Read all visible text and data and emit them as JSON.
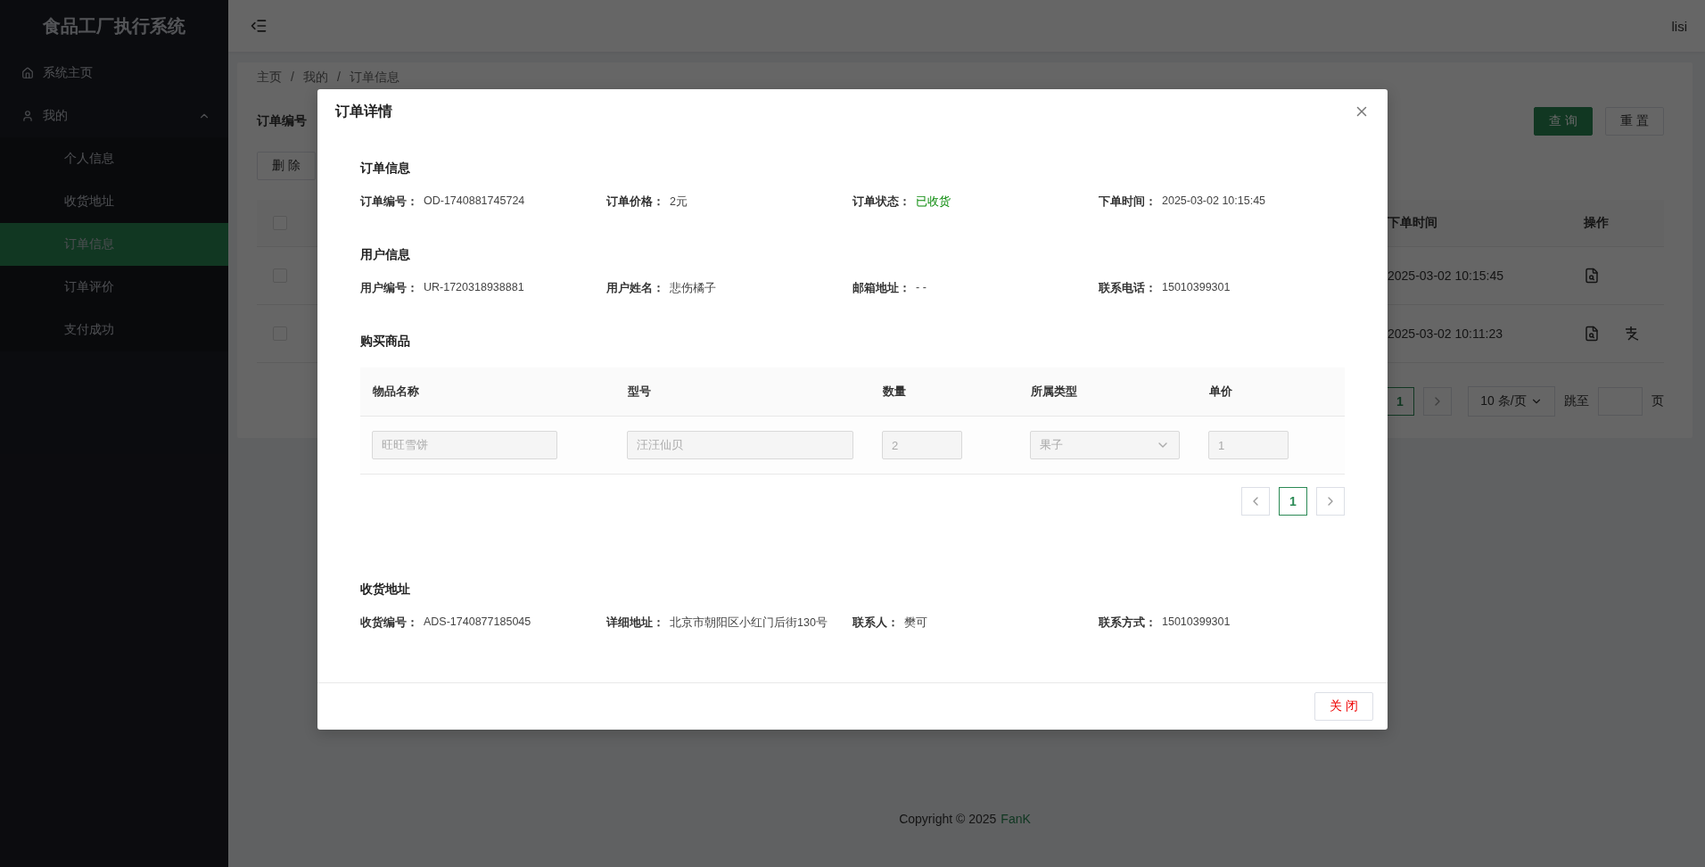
{
  "sidebar": {
    "title": "食品工厂执行系统",
    "items": [
      {
        "kind": "page",
        "label": "系统主页"
      },
      {
        "kind": "group",
        "label": "我的",
        "expanded": true,
        "children": [
          {
            "label": "个人信息",
            "selected": false
          },
          {
            "label": "收货地址",
            "selected": false
          },
          {
            "label": "订单信息",
            "selected": true
          },
          {
            "label": "订单评价",
            "selected": false
          },
          {
            "label": "支付成功",
            "selected": false
          }
        ]
      }
    ]
  },
  "header": {
    "user": "lisi"
  },
  "breadcrumb": {
    "items": [
      "主页",
      "我的",
      "订单信息"
    ],
    "separator": "/"
  },
  "filter": {
    "label": "订单编号",
    "buttons": [
      {
        "label": "查 询",
        "kind": "primary"
      },
      {
        "label": "重 置",
        "kind": "default"
      }
    ]
  },
  "toolbar": {
    "buttons": [
      "删 除"
    ]
  },
  "table": {
    "header_checked": false,
    "columns": [
      "下单时间",
      "操作"
    ],
    "rows": [
      {
        "checked": false,
        "time": "2025-03-02 10:15:45",
        "actions": [
          {
            "kind": "view"
          }
        ]
      },
      {
        "checked": false,
        "time": "2025-03-02 10:11:23",
        "actions": [
          {
            "kind": "view"
          },
          {
            "kind": "pay"
          }
        ]
      }
    ]
  },
  "pagination": {
    "pages": [
      {
        "label": "1",
        "selected": true
      }
    ],
    "page_size": "10 条/页",
    "jump_label": "跳至",
    "page_unit": "页"
  },
  "footer": {
    "text": "Copyright © 2025",
    "brand": "FanK"
  },
  "modal": {
    "title": "订单详情",
    "sections": [
      {
        "kind": "fields",
        "title": "订单信息",
        "fields": [
          {
            "label": "订单编号：",
            "value": "OD-1740881745724"
          },
          {
            "label": "订单价格：",
            "value": "2元"
          },
          {
            "label": "订单状态：",
            "value": "已收货",
            "kind": "status"
          },
          {
            "label": "下单时间：",
            "value": "2025-03-02 10:15:45"
          }
        ]
      },
      {
        "kind": "fields",
        "title": "用户信息",
        "fields": [
          {
            "label": "用户编号：",
            "value": "UR-1720318938881"
          },
          {
            "label": "用户姓名：",
            "value": "悲伤橘子"
          },
          {
            "label": "邮箱地址：",
            "value": "- -"
          },
          {
            "label": "联系电话：",
            "value": "15010399301"
          }
        ]
      },
      {
        "kind": "goods",
        "title": "购买商品",
        "columns": [
          "物品名称",
          "型号",
          "数量",
          "所属类型",
          "单价"
        ],
        "rows": [
          {
            "cells": [
              {
                "kind": "input",
                "value": "旺旺雪饼",
                "disabled": true
              },
              {
                "kind": "input",
                "value": "汪汪仙贝",
                "disabled": true
              },
              {
                "kind": "input",
                "value": "2",
                "disabled": true
              },
              {
                "kind": "select",
                "value": "果子",
                "disabled": true
              },
              {
                "kind": "input",
                "value": "1",
                "disabled": true
              }
            ]
          }
        ],
        "pages": [
          {
            "label": "1",
            "selected": true
          }
        ]
      },
      {
        "kind": "fields",
        "title": "收货地址",
        "fields": [
          {
            "label": "收货编号：",
            "value": "ADS-1740877185045"
          },
          {
            "label": "详细地址：",
            "value": "北京市朝阳区小红门后街130号"
          },
          {
            "label": "联系人：",
            "value": "樊可"
          },
          {
            "label": "联系方式：",
            "value": "15010399301"
          }
        ]
      }
    ],
    "close_button": "关 闭"
  }
}
